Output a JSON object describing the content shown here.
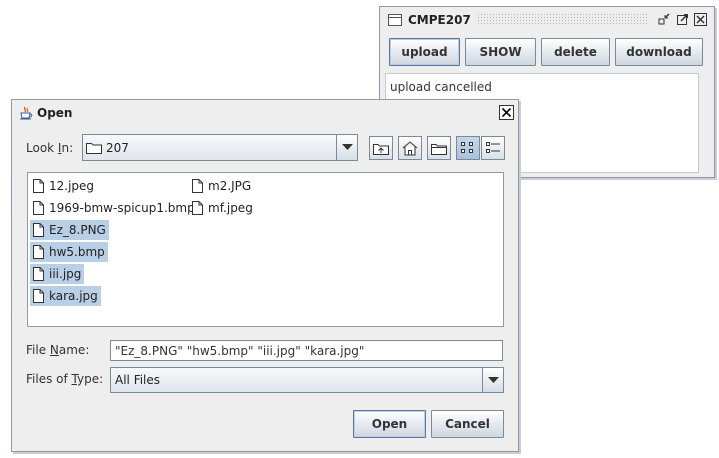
{
  "cmpe_window": {
    "title": "CMPE207",
    "buttons": [
      "upload",
      "SHOW",
      "delete",
      "download"
    ],
    "status_text": "upload cancelled"
  },
  "open_dialog": {
    "title": "Open",
    "look_in": {
      "label_before": "Look ",
      "label_mnemonic": "I",
      "label_after": "n:",
      "value": "207"
    },
    "files": [
      {
        "name": "12.jpeg",
        "selected": false
      },
      {
        "name": "1969-bmw-spicup1.bmp",
        "selected": false
      },
      {
        "name": "Ez_8.PNG",
        "selected": true
      },
      {
        "name": "hw5.bmp",
        "selected": true
      },
      {
        "name": "iii.jpg",
        "selected": true
      },
      {
        "name": "kara.jpg",
        "selected": true
      },
      {
        "name": "m2.JPG",
        "selected": false
      },
      {
        "name": "mf.jpeg",
        "selected": false
      }
    ],
    "file_name": {
      "label_before": "File ",
      "label_mnemonic": "N",
      "label_after": "ame:",
      "value": "\"Ez_8.PNG\" \"hw5.bmp\" \"iii.jpg\" \"kara.jpg\""
    },
    "files_of_type": {
      "label_before": "Files of ",
      "label_mnemonic": "T",
      "label_after": "ype:",
      "value": "All Files"
    },
    "open_button": "Open",
    "cancel_button": "Cancel"
  },
  "colors": {
    "selection": "#b8cfe5",
    "window_bg": "#eeeeee",
    "border": "#7a8a99"
  }
}
